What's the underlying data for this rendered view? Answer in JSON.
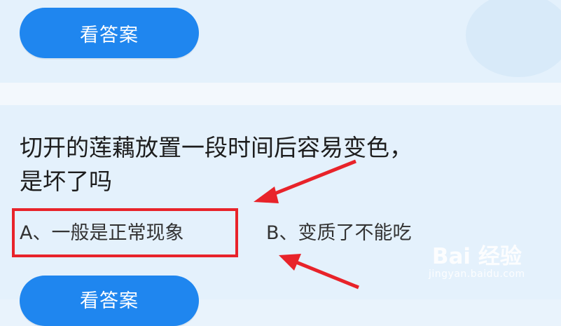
{
  "top_card": {
    "answer_button_label": "看答案"
  },
  "question_card": {
    "question_line1": "切开的莲藕放置一段时间后容易变色，",
    "question_line2": "是坏了吗",
    "option_a": "A、一般是正常现象",
    "option_b": "B、变质了不能吃",
    "answer_button_label": "看答案"
  },
  "annotations": {
    "highlight_color": "#e8232a",
    "arrow_color": "#e8232a"
  },
  "watermark": {
    "brand": "Bai 经验",
    "url": "jingyan.baidu.com"
  },
  "colors": {
    "button": "#1f86ef",
    "background": "#e4f1fc"
  }
}
